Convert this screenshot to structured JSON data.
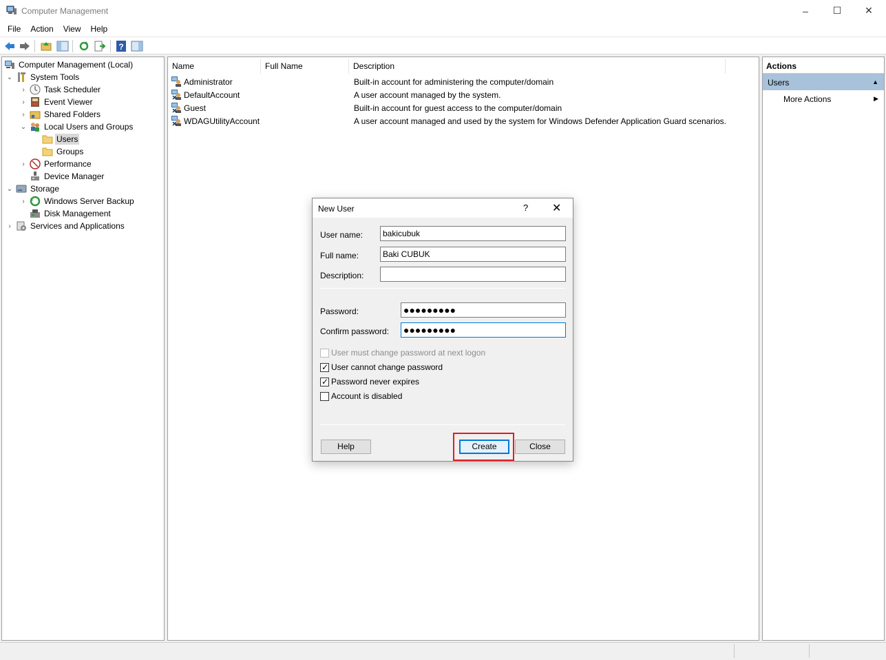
{
  "window": {
    "title": "Computer Management",
    "minimize": "–",
    "maximize": "☐",
    "close": "✕"
  },
  "menu": [
    "File",
    "Action",
    "View",
    "Help"
  ],
  "tree": {
    "root": "Computer Management (Local)",
    "system_tools": "System Tools",
    "task_scheduler": "Task Scheduler",
    "event_viewer": "Event Viewer",
    "shared_folders": "Shared Folders",
    "local_users_groups": "Local Users and Groups",
    "users": "Users",
    "groups": "Groups",
    "performance": "Performance",
    "device_manager": "Device Manager",
    "storage": "Storage",
    "windows_server_backup": "Windows Server Backup",
    "disk_management": "Disk Management",
    "services_apps": "Services and Applications"
  },
  "list": {
    "columns": [
      "Name",
      "Full Name",
      "Description"
    ],
    "rows": [
      {
        "name": "Administrator",
        "full_name": "",
        "description": "Built-in account for administering the computer/domain"
      },
      {
        "name": "DefaultAccount",
        "full_name": "",
        "description": "A user account managed by the system."
      },
      {
        "name": "Guest",
        "full_name": "",
        "description": "Built-in account for guest access to the computer/domain"
      },
      {
        "name": "WDAGUtilityAccount",
        "full_name": "",
        "description": "A user account managed and used by the system for Windows Defender Application Guard scenarios."
      }
    ]
  },
  "actions": {
    "title": "Actions",
    "section": "Users",
    "more_actions": "More Actions"
  },
  "dialog": {
    "title": "New User",
    "help_glyph": "?",
    "close_glyph": "✕",
    "username_label": "User name:",
    "username_value": "bakicubuk",
    "fullname_label": "Full name:",
    "fullname_value": "Baki CUBUK",
    "description_label": "Description:",
    "description_value": "",
    "password_label": "Password:",
    "password_value": "●●●●●●●●●",
    "confirm_label": "Confirm password:",
    "confirm_value": "●●●●●●●●●",
    "chk_must_change": "User must change password at next logon",
    "chk_cannot_change": "User cannot change password",
    "chk_never_expires": "Password never expires",
    "chk_disabled": "Account is disabled",
    "check_mark": "✓",
    "btn_help": "Help",
    "btn_create": "Create",
    "btn_close": "Close"
  },
  "colors": {
    "accent": "#0078d7",
    "highlight_box": "#e31b23",
    "actions_section_bg": "#a8c2dc"
  }
}
